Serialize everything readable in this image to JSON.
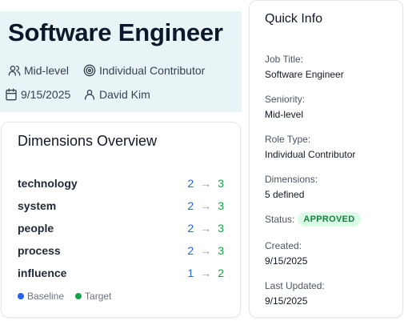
{
  "header": {
    "title": "Software Engineer",
    "level": "Mid-level",
    "role_type": "Individual Contributor",
    "date": "9/15/2025",
    "author": "David Kim"
  },
  "dimensions": {
    "title": "Dimensions Overview",
    "rows": [
      {
        "name": "technology",
        "baseline": "2",
        "target": "3"
      },
      {
        "name": "system",
        "baseline": "2",
        "target": "3"
      },
      {
        "name": "people",
        "baseline": "2",
        "target": "3"
      },
      {
        "name": "process",
        "baseline": "2",
        "target": "3"
      },
      {
        "name": "influence",
        "baseline": "1",
        "target": "2"
      }
    ],
    "arrow": "→",
    "legend": {
      "baseline": "Baseline",
      "target": "Target"
    }
  },
  "quick_info": {
    "title": "Quick Info",
    "job_title_label": "Job Title:",
    "job_title": "Software Engineer",
    "seniority_label": "Seniority:",
    "seniority": "Mid-level",
    "role_type_label": "Role Type:",
    "role_type": "Individual Contributor",
    "dimensions_label": "Dimensions:",
    "dimensions": "5 defined",
    "status_label": "Status:",
    "status": "APPROVED",
    "created_label": "Created:",
    "created": "9/15/2025",
    "updated_label": "Last Updated:",
    "updated": "9/15/2025"
  },
  "colors": {
    "header_bg": "#e9f4f7",
    "baseline": "#2563eb",
    "target": "#16a34a",
    "status_bg": "#dcfce7",
    "status_text": "#15803d"
  },
  "icons": [
    "users-icon",
    "target-icon",
    "calendar-icon",
    "user-icon"
  ]
}
